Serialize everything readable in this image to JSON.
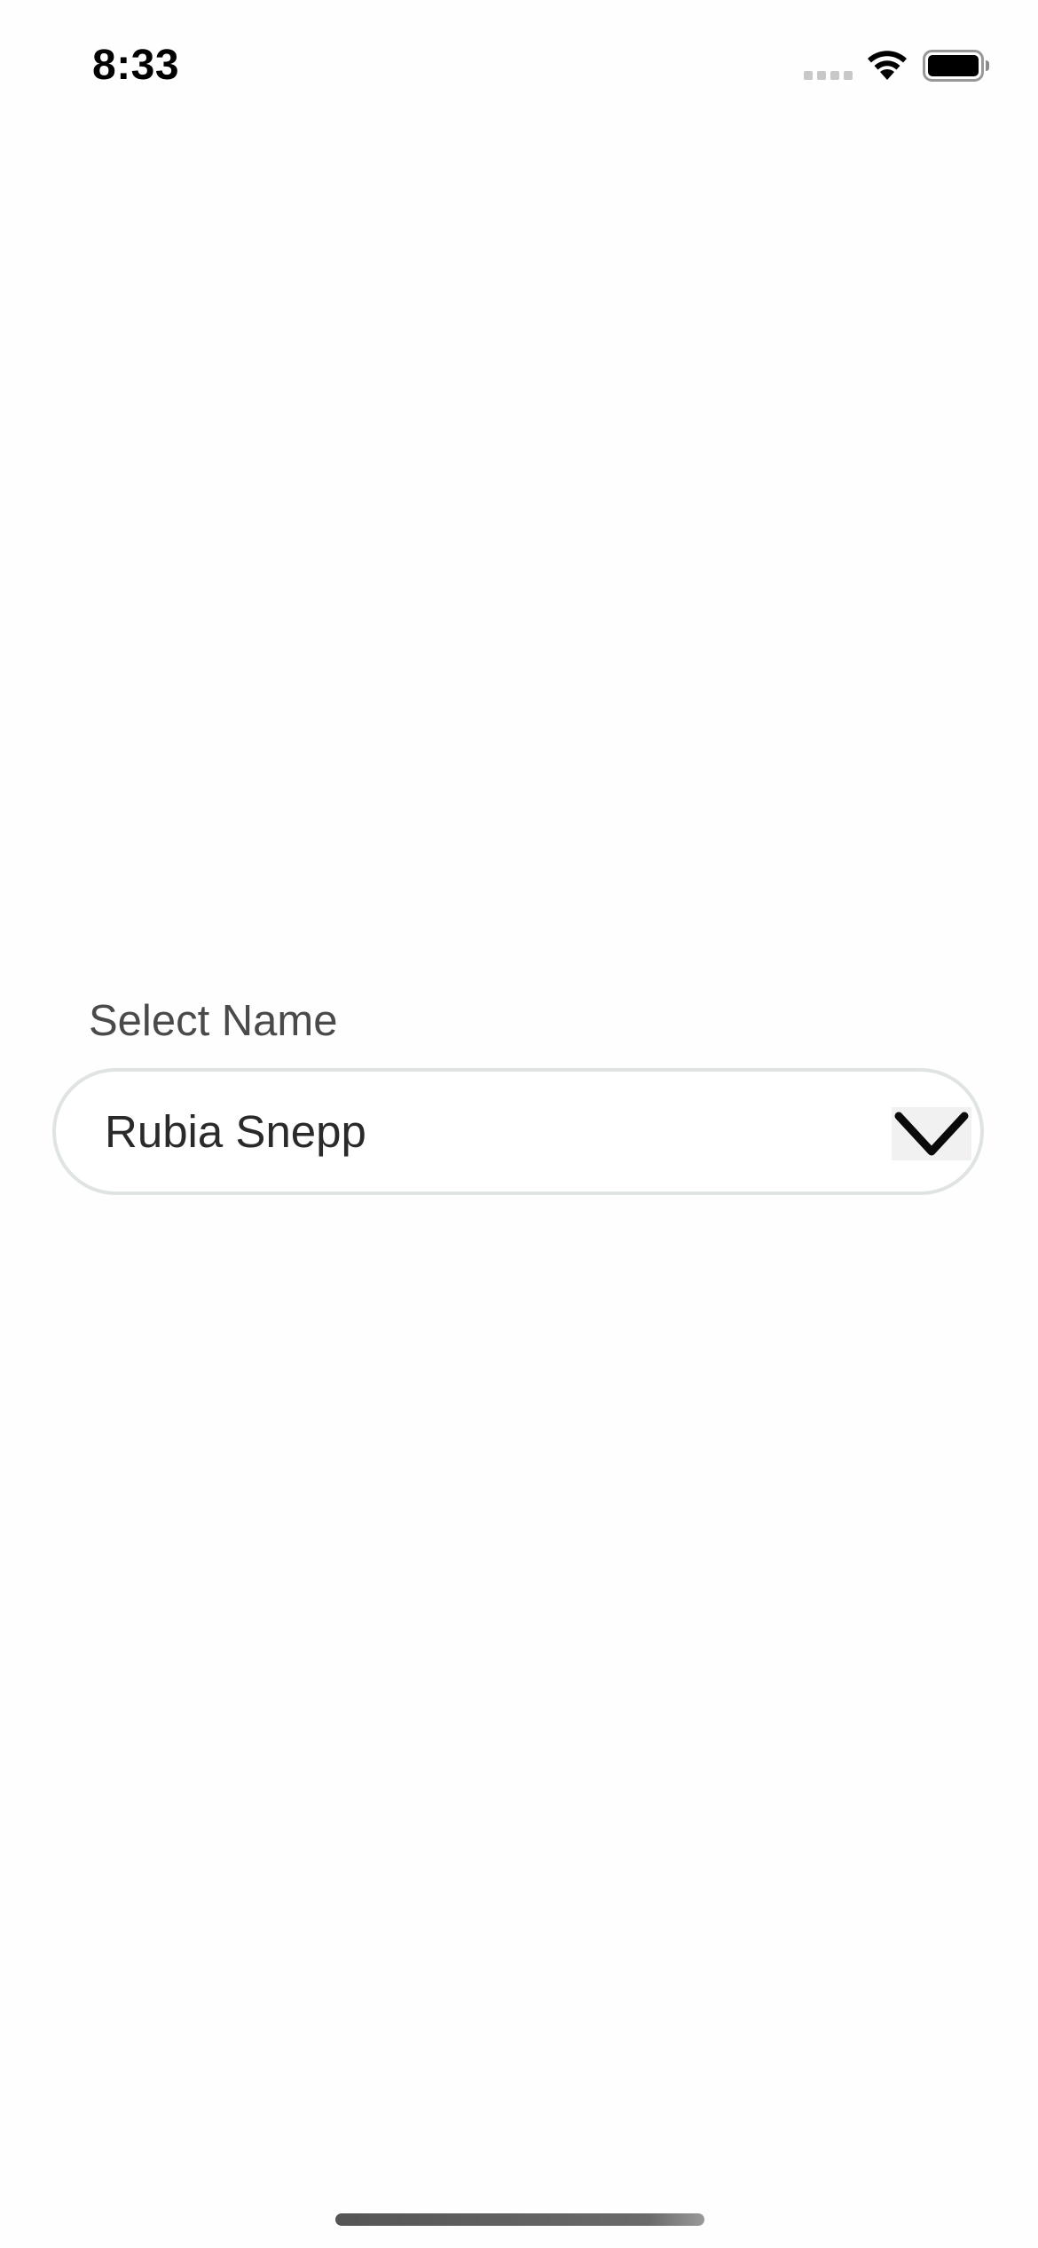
{
  "status_bar": {
    "time": "8:33",
    "signal_icon": "cellular-signal-empty-icon",
    "wifi_icon": "wifi-icon",
    "battery_icon": "battery-full-icon"
  },
  "picker": {
    "label": "Select Name",
    "selected_value": "Rubia Snepp",
    "dropdown_icon": "chevron-down-icon"
  },
  "colors": {
    "label_text": "#4a4a4a",
    "value_text": "#2a2a2a",
    "select_border": "#dfe3e3",
    "background": "#ffffff"
  }
}
